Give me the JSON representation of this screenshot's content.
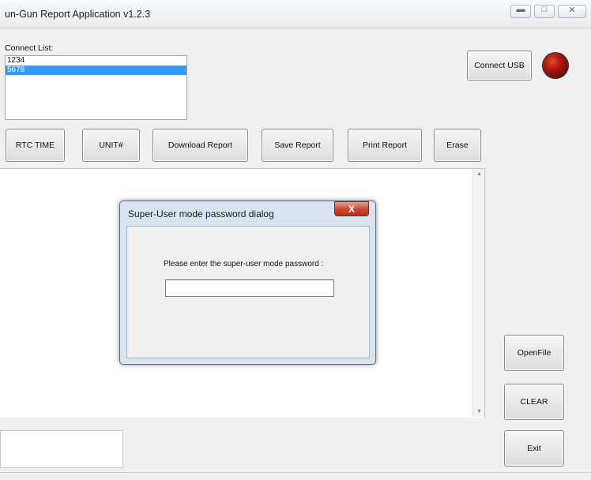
{
  "window": {
    "title": "un-Gun Report Application v1.2.3",
    "controls": [
      "minimize",
      "maximize",
      "close"
    ],
    "close_glyph": "✕"
  },
  "connect": {
    "label": "Connect List:",
    "items": [
      {
        "label": "1234",
        "selected": false
      },
      {
        "label": "5678",
        "selected": true
      }
    ],
    "usb_button": "Connect USB",
    "led_color": "#b0180f"
  },
  "toolbar": {
    "rtc_time": "RTC TIME",
    "unit": "UNIT#",
    "download_report": "Download Report",
    "save_report": "Save Report",
    "print_report": "Print Report",
    "erase": "Erase"
  },
  "side_buttons": {
    "open_file": "OpenFile",
    "clear": "CLEAR",
    "exit": "Exit"
  },
  "dialog": {
    "title": "Super-User mode password dialog",
    "prompt": "Please enter the super-user mode password :",
    "password_value": "",
    "close_glyph": "X"
  },
  "colors": {
    "selection": "#3399ff",
    "dialog_close": "#c7452c"
  }
}
